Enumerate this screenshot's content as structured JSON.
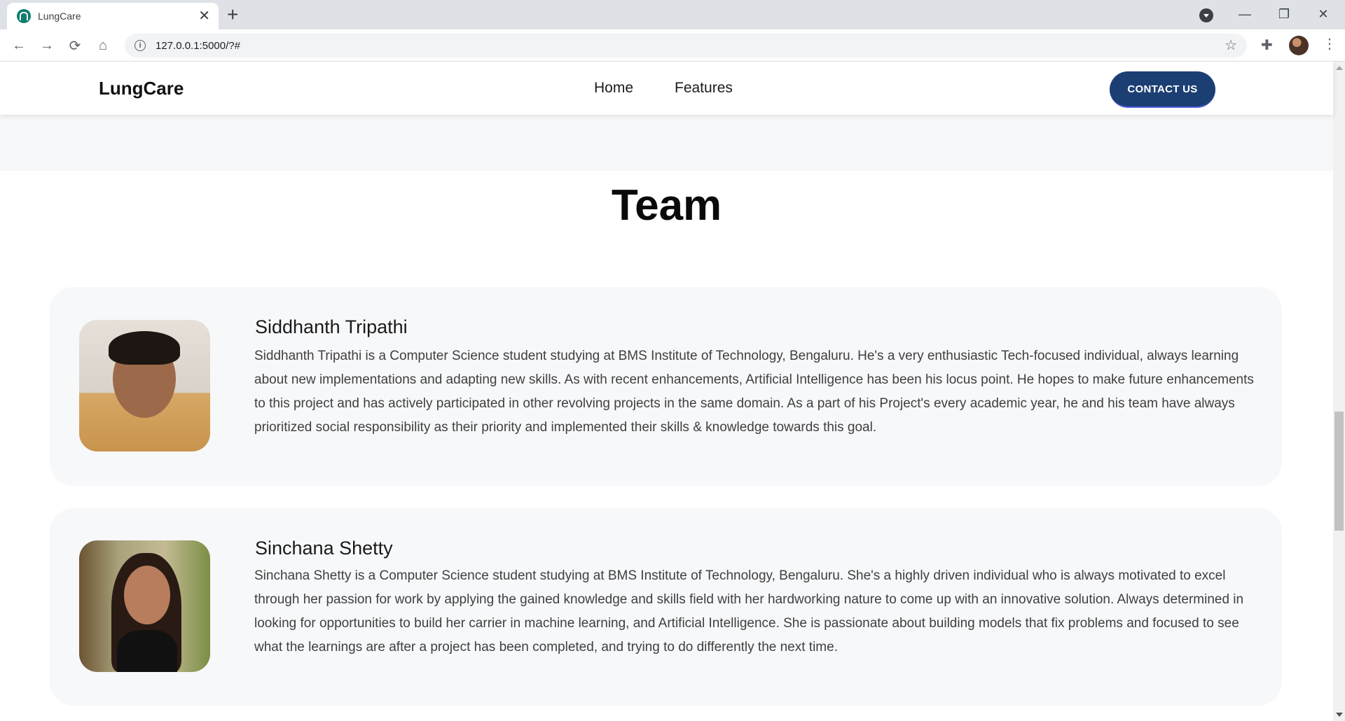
{
  "browser": {
    "tab_title": "LungCare",
    "new_tab": "+",
    "url": "127.0.0.1:5000/?#",
    "window_controls": [
      "—",
      "❐",
      "✕"
    ]
  },
  "navbar": {
    "brand": "LungCare",
    "links": [
      "Home",
      "Features"
    ],
    "contact_label": "CONTACT US"
  },
  "team": {
    "heading": "Team",
    "members": [
      {
        "name": "Siddhanth Tripathi",
        "bio": "Siddhanth Tripathi is a Computer Science student studying at BMS Institute of Technology, Bengaluru. He's a very enthusiastic Tech-focused individual, always learning about new implementations and adapting new skills. As with recent enhancements, Artificial Intelligence has been his locus point. He hopes to make future enhancements to this project and has actively participated in other revolving projects in the same domain. As a part of his Project's every academic year, he and his team have always prioritized social responsibility as their priority and implemented their skills & knowledge towards this goal."
      },
      {
        "name": "Sinchana Shetty",
        "bio": "Sinchana Shetty is a Computer Science student studying at BMS Institute of Technology, Bengaluru. She's a highly driven individual who is always motivated to excel through her passion for work by applying the gained knowledge and skills field with her hardworking nature to come up with an innovative solution. Always determined in looking for opportunities to build her carrier in machine learning, and Artificial Intelligence. She is passionate about building models that fix problems and focused to see what the learnings are after a project has been completed, and trying to do differently the next time."
      }
    ]
  },
  "colors": {
    "contact_button": "#1c3f73",
    "card_background": "#f7f8fa"
  }
}
